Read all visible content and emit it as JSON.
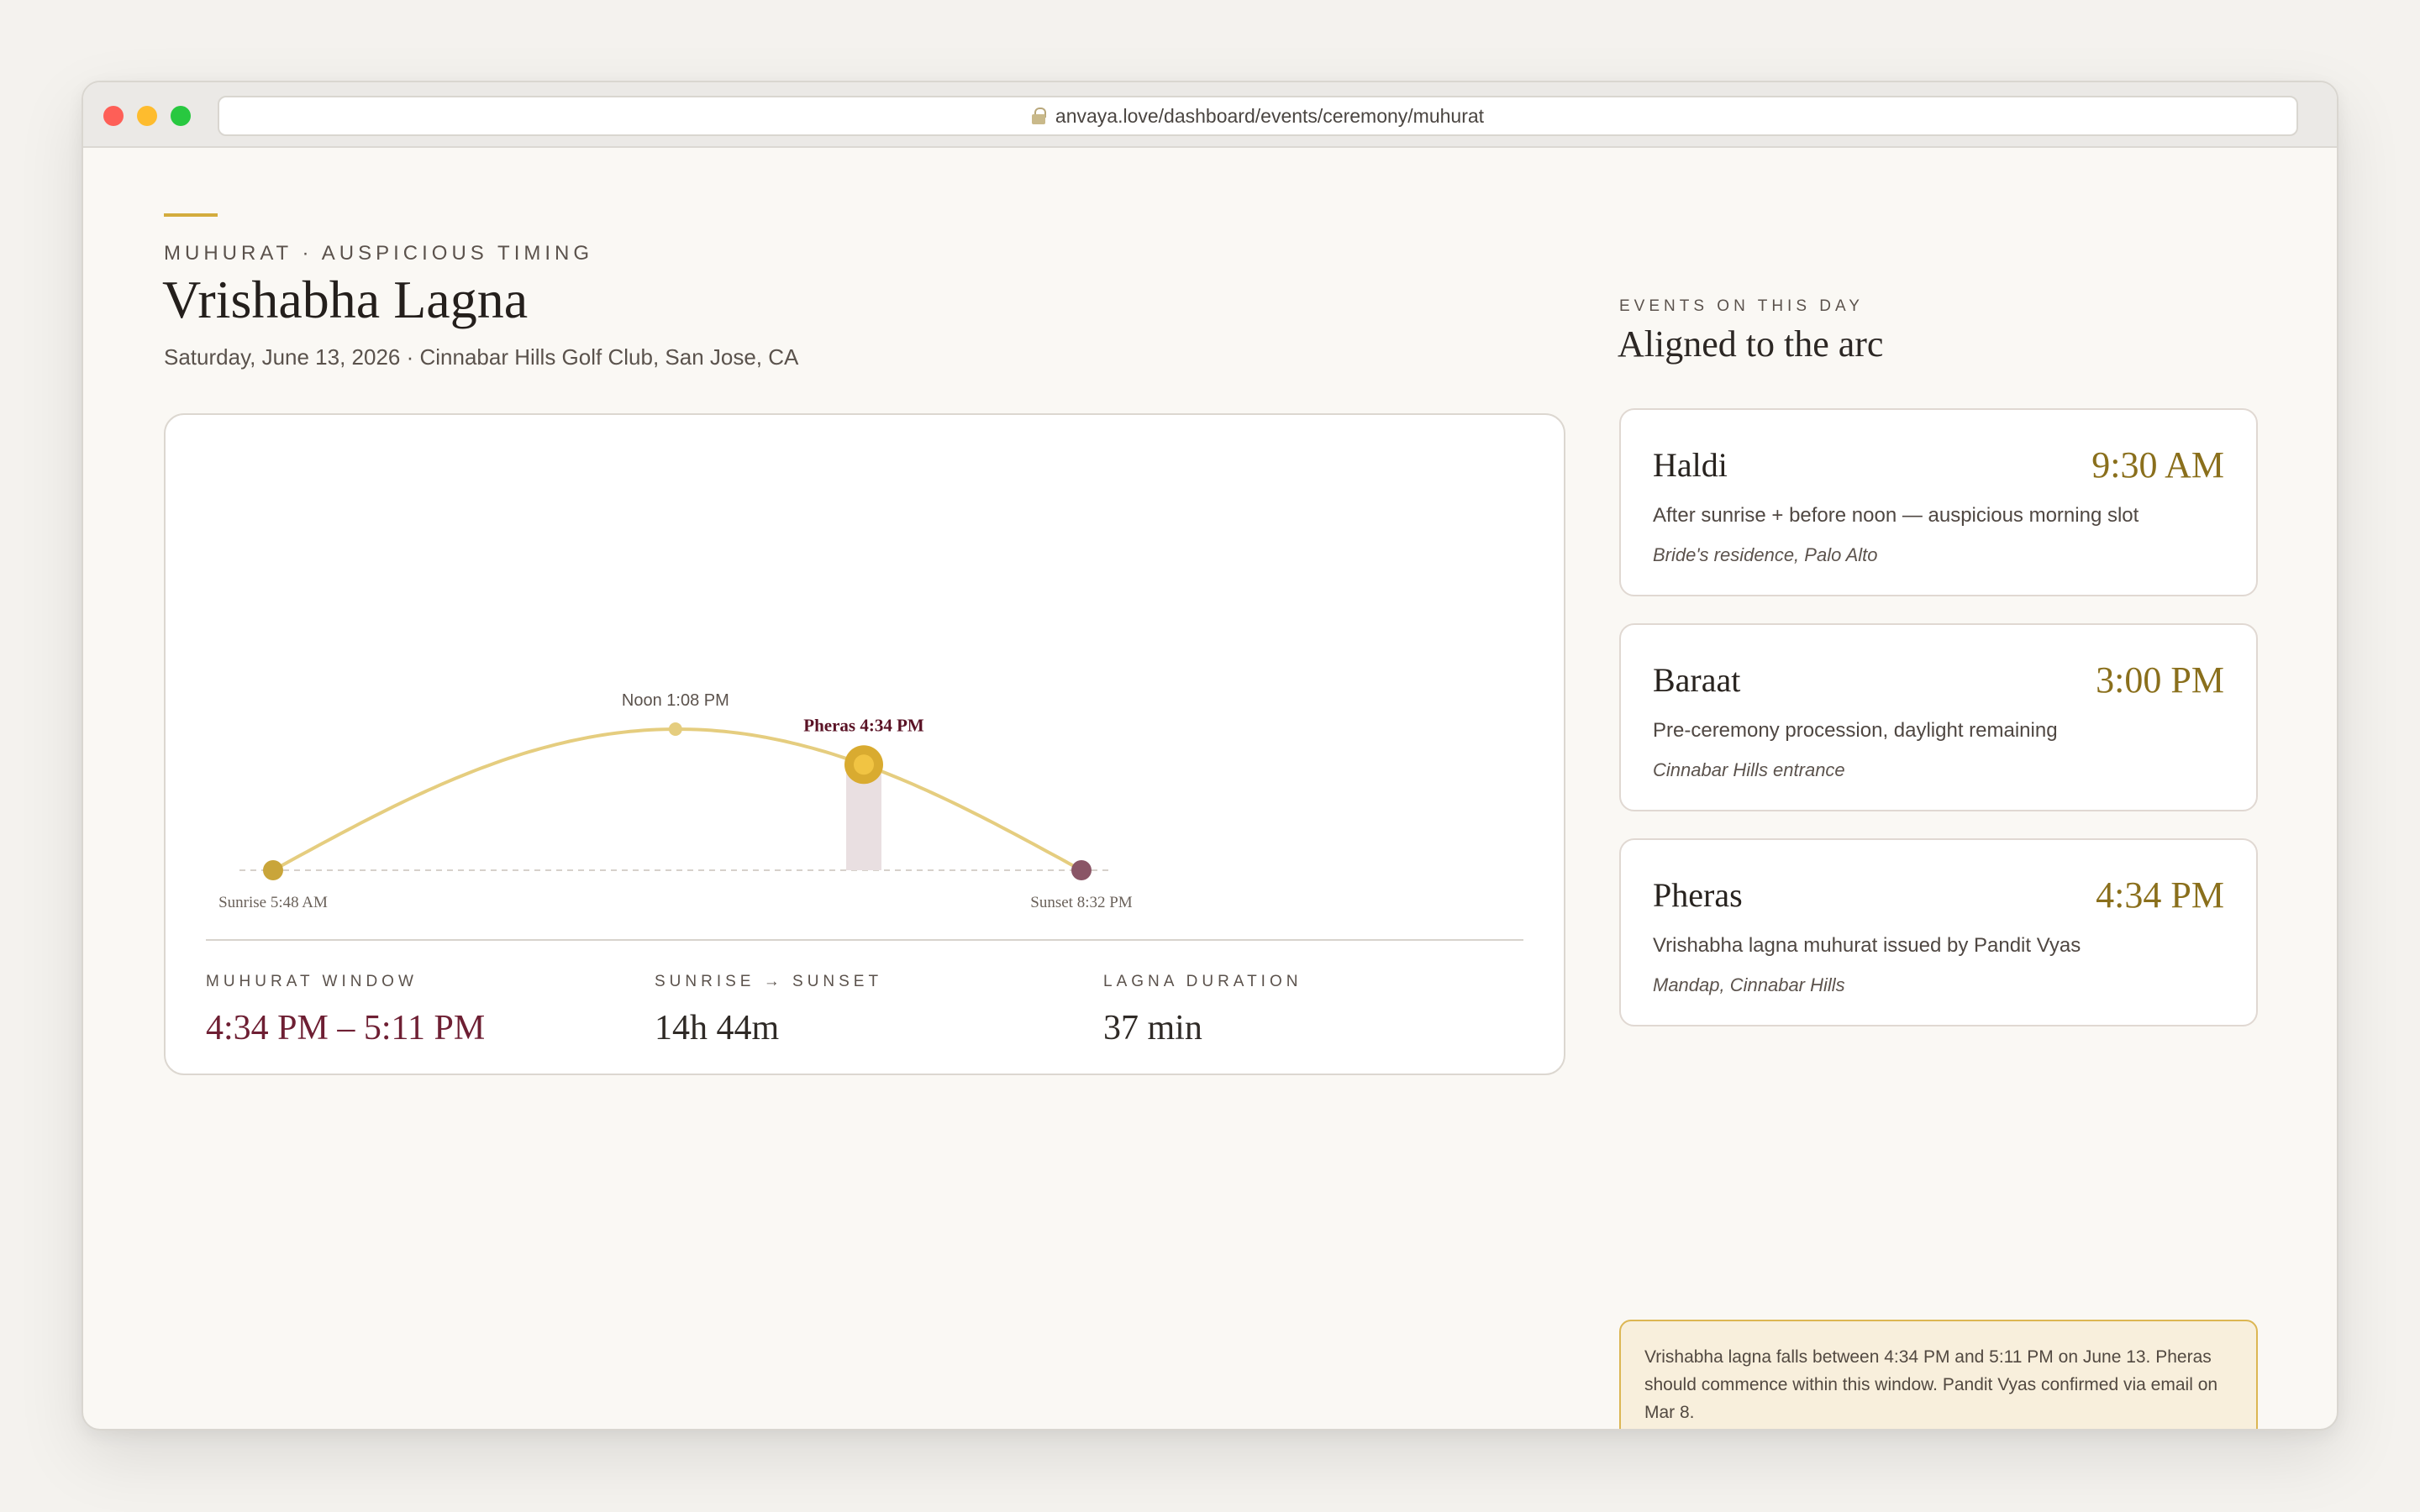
{
  "browser": {
    "url": "anvaya.love/dashboard/events/ceremony/muhurat"
  },
  "header": {
    "eyebrow": "MUHURAT · AUSPICIOUS TIMING",
    "title": "Vrishabha Lagna",
    "subline": "Saturday, June 13, 2026 · Cinnabar Hills Golf Club, San Jose, CA"
  },
  "arc": {
    "sunrise_label": "Sunrise 5:48 AM",
    "noon_label": "Noon 1:08 PM",
    "pheras_label": "Pheras 4:34 PM",
    "sunset_label": "Sunset 8:32 PM",
    "sunrise_min": 348,
    "sunset_min": 1232,
    "noon_min": 788,
    "pheras_min": 994,
    "colors": {
      "arc": "#e5cd7f",
      "sunrise": "#c9a53a",
      "sunset": "#8a5566",
      "pheras": "#d9ab30",
      "window": "#e9dfe1",
      "pheras_text": "#5a1225"
    }
  },
  "stats": [
    {
      "label": "MUHURAT WINDOW",
      "value": "4:34 PM – 5:11 PM"
    },
    {
      "label": "SUNRISE → SUNSET",
      "value": "14h 44m"
    },
    {
      "label": "LAGNA DURATION",
      "value": "37 min"
    }
  ],
  "sidebar": {
    "eyebrow": "EVENTS ON THIS DAY",
    "title": "Aligned to the arc",
    "events": [
      {
        "name": "Haldi",
        "time": "9:30 AM",
        "description": "After sunrise + before noon — auspicious morning slot",
        "place": "Bride's residence, Palo Alto"
      },
      {
        "name": "Baraat",
        "time": "3:00 PM",
        "description": "Pre-ceremony procession, daylight remaining",
        "place": "Cinnabar Hills entrance"
      },
      {
        "name": "Pheras",
        "time": "4:34 PM",
        "description": "Vrishabha lagna muhurat issued by Pandit Vyas",
        "place": "Mandap, Cinnabar Hills"
      }
    ],
    "note": "Vrishabha lagna falls between 4:34 PM and 5:11 PM on June 13. Pheras should commence within this window. Pandit Vyas confirmed via email on Mar 8."
  }
}
